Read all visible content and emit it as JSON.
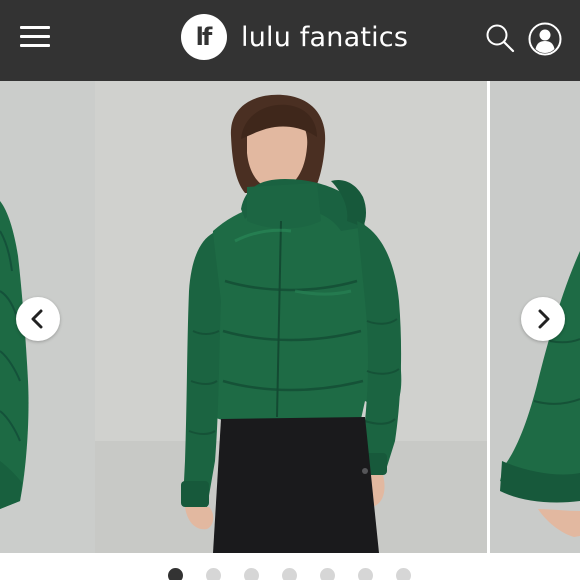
{
  "header": {
    "logo_mark": "lf",
    "brand_name": "lulu fanatics",
    "menu_icon": "hamburger-menu-icon",
    "search_icon": "search-icon",
    "profile_icon": "user-profile-icon",
    "background": "#333333"
  },
  "carousel": {
    "prev_icon": "chevron-left-icon",
    "next_icon": "chevron-right-icon",
    "jacket_color": "#1e6b45",
    "slide_count": 7,
    "active_slide": 1
  }
}
